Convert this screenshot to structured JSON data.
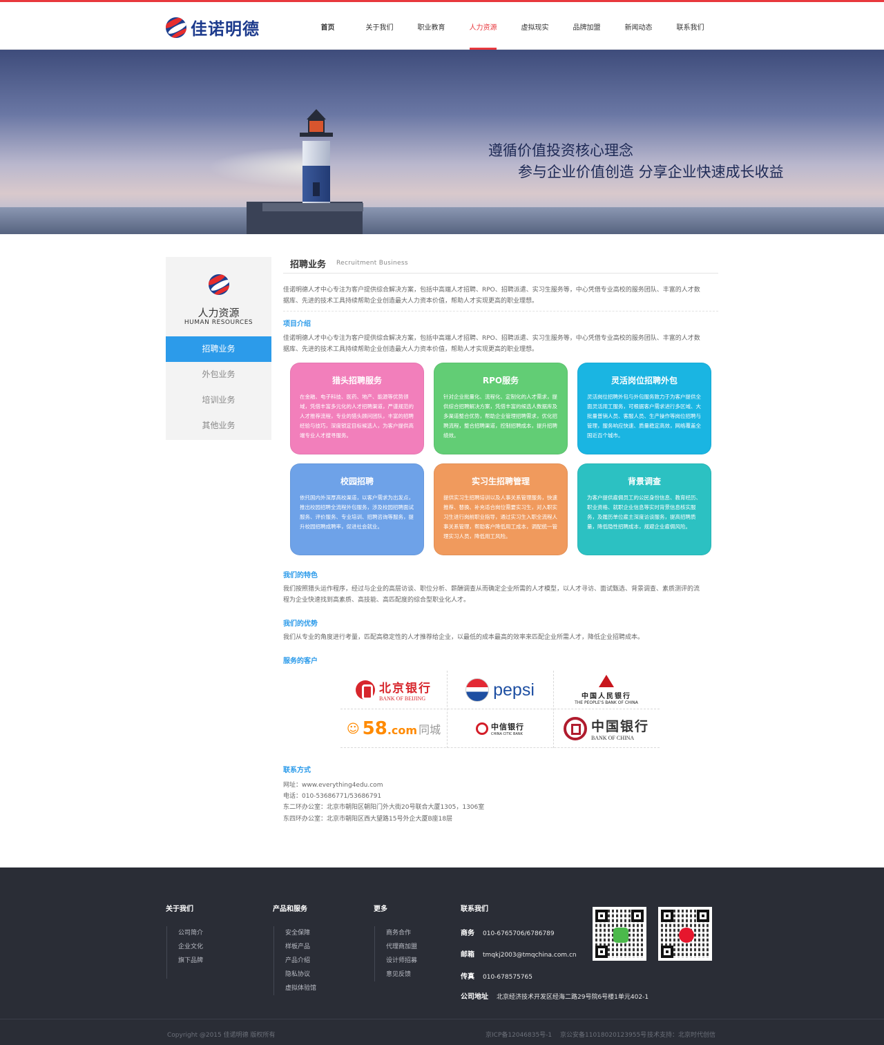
{
  "brand": {
    "name": "佳诺明德"
  },
  "nav": {
    "items": [
      {
        "label": "首页"
      },
      {
        "label": "关于我们"
      },
      {
        "label": "职业教育"
      },
      {
        "label": "人力资源"
      },
      {
        "label": "虚拟现实"
      },
      {
        "label": "品牌加盟"
      },
      {
        "label": "新闻动态"
      },
      {
        "label": "联系我们"
      }
    ],
    "active": "人力资源"
  },
  "banner": {
    "line1": "遵循价值投资核心理念",
    "line2": "参与企业价值创造 分享企业快速成长收益"
  },
  "sidebar": {
    "title": "人力资源",
    "subtitle": "HUMAN  RESOURCES",
    "items": [
      {
        "label": "招聘业务"
      },
      {
        "label": "外包业务"
      },
      {
        "label": "培训业务"
      },
      {
        "label": "其他业务"
      }
    ],
    "active": "招聘业务"
  },
  "main": {
    "title": "招聘业务",
    "title_en": "Recruitment  Business",
    "intro_line1": "佳诺明德人才中心专注为客户提供综合解决方案，包括中高端人才招聘、RPO、招聘派遣、实习生服务等，中心凭借专业高校的服务团队、丰富的人才数",
    "intro_line2": "据库、先进的技术工具持续帮助企业创造最大人力资本价值，帮助人才实现更高的职业理想。",
    "project": {
      "heading": "项目介绍",
      "line1": "佳诺明德人才中心专注为客户提供综合解决方案，包括中高端人才招聘、RPO、招聘派遣、实习生服务等，中心凭借专业高校的服务团队、丰富的人才数",
      "line2": "据库、先进的技术工具持续帮助企业创造最大人力资本价值，帮助人才实现更高的职业理想。"
    },
    "cards": [
      {
        "title": "猎头招聘服务",
        "color": "#f27fbb",
        "text": "在金融、电子科技、医药、地产、能源等优势领域，凭借丰富多元化的人才招聘渠道，严谨规范的人才推荐流程，专业的猎头顾问团队，丰富的招聘经验与技巧，深度锁定目标候选人，为客户提供高端专业人才搜寻服务。"
      },
      {
        "title": "RPO服务",
        "color": "#62cd75",
        "text": "针对企业批量化、流程化、定制化的人才需求，提供综合招聘解决方案，凭借丰富的候选人数据库及多渠道整合优势，帮助企业管理招聘需求，优化招聘流程，整合招聘渠道，控制招聘成本，提升招聘绩效。"
      },
      {
        "title": "灵活岗位招聘外包",
        "color": "#1ab5e2",
        "text": "灵活岗位招聘外包与外包服务致力于为客户提供全面灵活用工服务，可根据客户需求进行多区域、大批量普销人员、客服人员、生产操作等岗位招聘与管理，服务响应快速、质量稳定高效，网络覆盖全国近百个城市。"
      },
      {
        "title": "校园招聘",
        "color": "#6ea2e8",
        "text": "依托国内外深厚高校渠道，以客户需求为出发点，推出校园招聘全流程外包服务，涉及校园招聘面试服务、评价服务、专业培训、招聘咨询等服务，提升校园招聘成聘率，促进社会就业。"
      },
      {
        "title": "实习生招聘管理",
        "color": "#f09a5d",
        "text": "提供实习生招聘培训以及人事关系管理服务，快速推荐、替换、补充适合岗位需要实习生，对入职实习生进行岗前职业指导，通过实习生入职全流程人事关系管理，帮助客户降低用工成本，调配统一管理实习人员，降低用工风险。"
      },
      {
        "title": "背景调查",
        "color": "#2cc1c2",
        "text": "为客户提供雇佣员工的公民身份信息、教育经历、职业资格、就职企业信息等实时背景信息核实服务，及履历单位雇主深度访谈服务，提高招聘质量，降低隐性招聘成本，规避企业雇佣风险。"
      }
    ],
    "features": {
      "heading": "我们的特色",
      "line1": "我们按照猎头运作程序，经过与企业的高层访谈、职位分析、薪酬调查从而确定企业所需的人才模型，以人才寻访、面试甄选、背景调查、素质测评的流",
      "line2": "程为企业快速找到高素质、高技能、高匹配度的综合型职业化人才。"
    },
    "advantage": {
      "heading": "我们的优势",
      "text": "我们从专业的角度进行考量，匹配高稳定性的人才推荐给企业，以最低的成本最高的效率来匹配企业所需人才，降低企业招聘成本。"
    },
    "clients": {
      "heading": "服务的客户",
      "bank_of_beijing": {
        "cn": "北京银行",
        "en": "BANK OF BEIJING"
      },
      "pepsi": {
        "name": "pepsi"
      },
      "pboc": {
        "cn": "中国人民银行",
        "en": "THE PEOPLE'S BANK OF CHINA"
      },
      "tongcheng": {
        "num": "58",
        "dotcom": ".com",
        "cn": "同城"
      },
      "citic": {
        "cn": "中信银行",
        "en": "CHINA CITIC BANK"
      },
      "boc": {
        "cn": "中国银行",
        "en": "BANK OF CHINA"
      }
    },
    "contact": {
      "heading": "联系方式",
      "website": "网址：www.everything4edu.com",
      "phone": "电话：010-53686771/53686791",
      "office1": "东二环办公室：北京市朝阳区朝阳门外大街20号联合大厦1305，1306室",
      "office2": "东四环办公室：北京市朝阳区西大望路15号外企大厦B座18层"
    }
  },
  "footer": {
    "about": {
      "title": "关于我们",
      "links": [
        "公司简介",
        "企业文化",
        "旗下品牌"
      ]
    },
    "products": {
      "title": "产品和服务",
      "links": [
        "安全保障",
        "样板产品",
        "产品介绍",
        "隐私协议",
        "虚拟体验馆"
      ]
    },
    "more": {
      "title": "更多",
      "links": [
        "商务合作",
        "代理商加盟",
        "设计师招募",
        "意见反馈"
      ]
    },
    "contact": {
      "title": "联系我们",
      "business_label": "商务",
      "business": "010-6765706/6786789",
      "email_label": "邮箱",
      "email": "tmqkj2003@tmqchina.com.cn",
      "fax_label": "传真",
      "fax": "010-678575765",
      "address_label": "公司地址",
      "address": "北京经济技术开发区经海二路29号院6号楼1单元402-1"
    },
    "qr_icons": [
      "wechat-icon",
      "weibo-icon"
    ],
    "copyright": "Copyright @2015 佳诺明德 版权所有",
    "icp": "京ICP备12046835号-1",
    "police": "京公安备11018020123955号",
    "support": "技术支持：北京时代创信"
  },
  "colors": {
    "accent_red": "#e8383d",
    "accent_blue": "#2c9bea",
    "footer_bg": "#2a2d36"
  }
}
